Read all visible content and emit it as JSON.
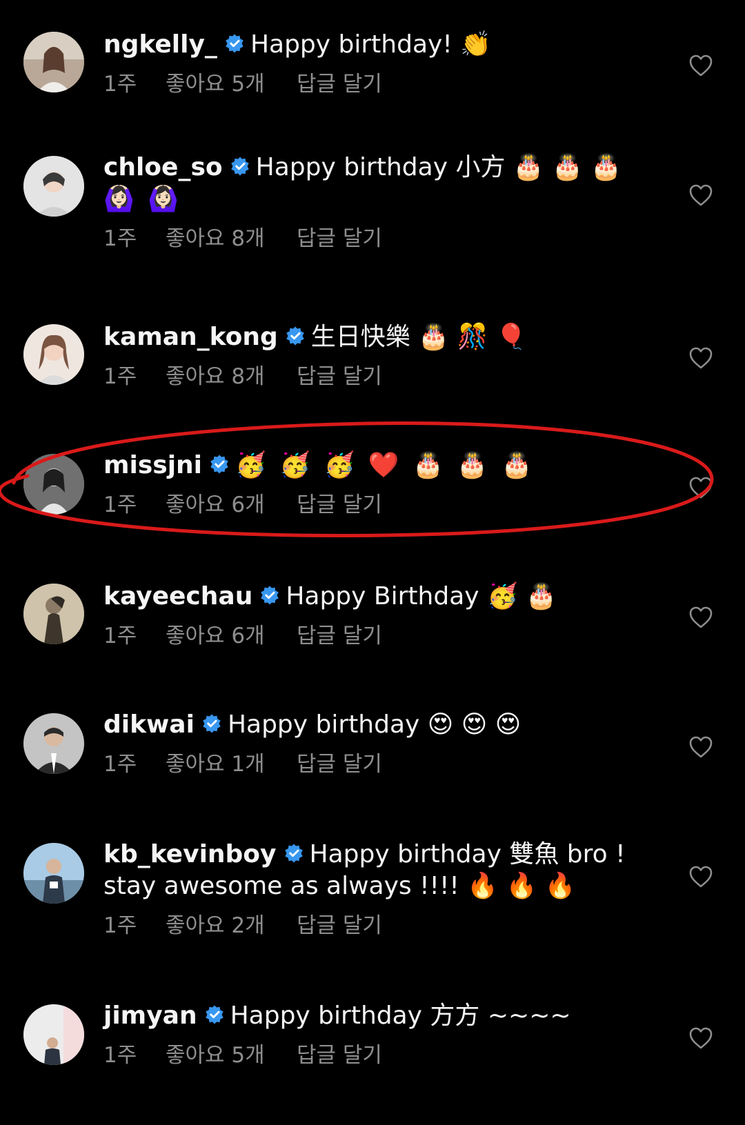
{
  "comments": [
    {
      "username": "ngkelly_",
      "text": "Happy birthday! 👏",
      "text2": "",
      "time": "1주",
      "likes": "좋아요 5개",
      "reply": "답글 달기",
      "avatar_colors": [
        "#cbb9a8",
        "#7a5a48"
      ]
    },
    {
      "username": "chloe_so",
      "text": "Happy birthday 小方 🎂 🎂 🎂",
      "text2": "🙆🏻‍♀️ 🙆🏻‍♀️",
      "time": "1주",
      "likes": "좋아요 8개",
      "reply": "답글 달기",
      "avatar_colors": [
        "#d9d9d9",
        "#4a4a4a"
      ]
    },
    {
      "username": "kaman_kong",
      "text": "生日快樂 🎂 🎊 🎈",
      "text2": "",
      "time": "1주",
      "likes": "좋아요 8개",
      "reply": "답글 달기",
      "avatar_colors": [
        "#e8d8cf",
        "#6d4a3c"
      ]
    },
    {
      "username": "missjni",
      "text": "🥳 🥳 🥳 ❤️ 🎂 🎂 🎂",
      "text2": "",
      "time": "1주",
      "likes": "좋아요 6개",
      "reply": "답글 달기",
      "avatar_colors": [
        "#a8a8a8",
        "#2b2b2b"
      ]
    },
    {
      "username": "kayeechau",
      "text": "Happy Birthday 🥳 🎂",
      "text2": "",
      "time": "1주",
      "likes": "좋아요 6개",
      "reply": "답글 달기",
      "avatar_colors": [
        "#c9bda6",
        "#4d4336"
      ]
    },
    {
      "username": "dikwai",
      "text": "Happy birthday 😍 😍 😍",
      "text2": "",
      "time": "1주",
      "likes": "좋아요 1개",
      "reply": "답글 달기",
      "avatar_colors": [
        "#bdbdbd",
        "#2c2c2c"
      ]
    },
    {
      "username": "kb_kevinboy",
      "text": "Happy birthday 雙魚 bro !",
      "text2": "stay awesome as always !!!! 🔥 🔥 🔥",
      "time": "1주",
      "likes": "좋아요 2개",
      "reply": "답글 달기",
      "avatar_colors": [
        "#9dc3e0",
        "#2e3b4a"
      ]
    },
    {
      "username": "jimyan",
      "text": "Happy birthday 方方 ~~~~",
      "text2": "",
      "time": "1주",
      "likes": "좋아요 5개",
      "reply": "답글 달기",
      "avatar_colors": [
        "#e6e6e6",
        "#3a3a3a"
      ]
    }
  ],
  "icons": {
    "verified": "verified-badge-icon",
    "like": "heart-outline-icon"
  },
  "colors": {
    "background": "#000000",
    "text": "#f5f5f5",
    "meta": "#8e8e8e",
    "verified": "#3897f0",
    "highlight_ellipse": "#d91a1a"
  }
}
